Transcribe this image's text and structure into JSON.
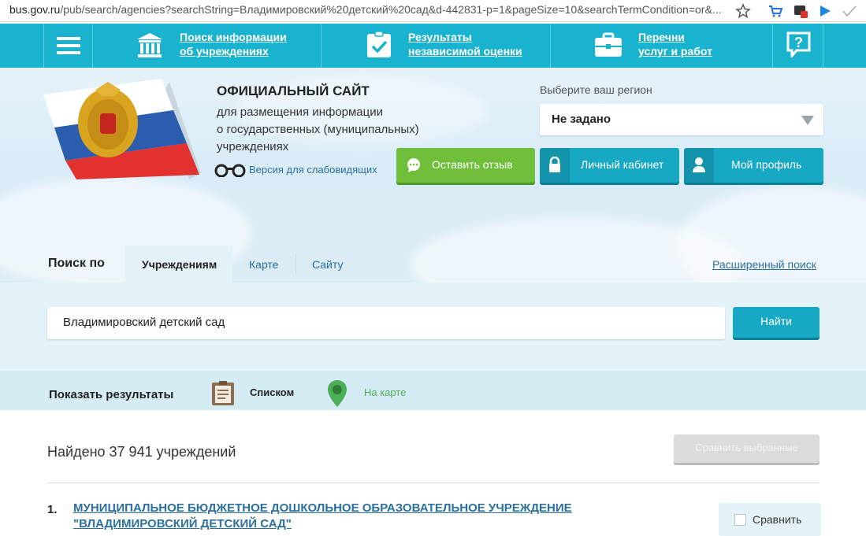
{
  "browser": {
    "url_host": "bus.gov.ru",
    "url_path": "/pub/search/agencies?searchString=Владимировский%20детский%20сад&d-442831-p=1&pageSize=10&searchTermCondition=or&..."
  },
  "topnav": {
    "menu_icon": "hamburger-icon",
    "items": [
      {
        "line1": "Поиск информации",
        "line2": "об учреждениях",
        "icon": "building-icon"
      },
      {
        "line1": "Результаты",
        "line2": "независимой оценки",
        "icon": "clipboard-check-icon"
      },
      {
        "line1": "Перечни",
        "line2": "услуг и работ",
        "icon": "briefcase-icon"
      }
    ],
    "help_icon": "question-icon"
  },
  "header": {
    "title": "ОФИЦИАЛЬНЫЙ САЙТ",
    "subtitle_lines": [
      "для размещения информации",
      "о государственных (муниципальных)",
      "учреждениях"
    ],
    "vision_link": "Версия для слабовидящих",
    "region_label": "Выберите ваш регион",
    "region_value": "Не задано"
  },
  "actions": {
    "feedback": "Оставить отзыв",
    "cabinet": "Личный кабинет",
    "profile": "Мой профиль"
  },
  "search": {
    "by_label": "Поиск по",
    "tabs": [
      "Учреждениям",
      "Карте",
      "Сайту"
    ],
    "advanced": "Расширенный поиск",
    "query": "Владимировский детский сад",
    "find_button": "Найти"
  },
  "display": {
    "label": "Показать результаты",
    "list": "Списком",
    "map": "На карте"
  },
  "results": {
    "found_text": "Найдено 37 941 учреждений",
    "compare_selected": "Сравнить выбранные",
    "items": [
      {
        "num": "1.",
        "title_line1": "МУНИЦИПАЛЬНОЕ БЮДЖЕТНОЕ ДОШКОЛЬНОЕ ОБРАЗОВАТЕЛЬНОЕ УЧРЕЖДЕНИЕ",
        "title_line2": "\"ВЛАДИМИРОВСКИЙ ДЕТСКИЙ САД\"",
        "compare": "Сравнить"
      }
    ]
  },
  "colors": {
    "teal": "#1ab3cf",
    "green": "#6fbf3a",
    "link": "#2a6f9e"
  }
}
